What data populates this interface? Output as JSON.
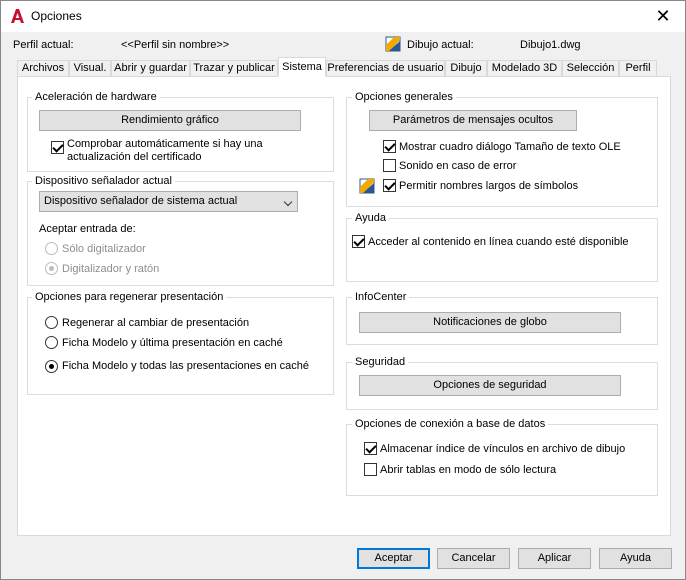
{
  "window": {
    "title": "Opciones",
    "close": "✕"
  },
  "profile": {
    "label": "Perfil actual:",
    "value": "<<Perfil sin nombre>>"
  },
  "drawing": {
    "label": "Dibujo actual:",
    "value": "Dibujo1.dwg"
  },
  "tabs": [
    {
      "label": "Archivos"
    },
    {
      "label": "Visual."
    },
    {
      "label": "Abrir y guardar"
    },
    {
      "label": "Trazar y publicar"
    },
    {
      "label": "Sistema"
    },
    {
      "label": "Preferencias de usuario"
    },
    {
      "label": "Dibujo"
    },
    {
      "label": "Modelado 3D"
    },
    {
      "label": "Selección"
    },
    {
      "label": "Perfil"
    }
  ],
  "hardware": {
    "title": "Aceleración de hardware",
    "button": "Rendimiento gráfico",
    "check_label_1": "Comprobar automáticamente si hay una",
    "check_label_2": "actualización del certificado"
  },
  "pointing": {
    "title": "Dispositivo señalador actual",
    "selected": "Dispositivo señalador de sistema actual",
    "accept_label": "Aceptar entrada de:",
    "radio1": "Sólo digitalizador",
    "radio2": "Digitalizador y ratón"
  },
  "regen": {
    "title": "Opciones para regenerar presentación",
    "opt1": "Regenerar al cambiar de presentación",
    "opt2": "Ficha Modelo y última presentación en caché",
    "opt3": "Ficha Modelo y todas las presentaciones en caché"
  },
  "general": {
    "title": "Opciones generales",
    "button": "Parámetros de mensajes ocultos",
    "chk1": "Mostrar cuadro diálogo Tamaño de texto OLE",
    "chk2": "Sonido en caso de error",
    "chk3": "Permitir nombres largos de símbolos"
  },
  "help": {
    "title": "Ayuda",
    "chk": "Acceder al contenido en línea cuando esté disponible"
  },
  "infocenter": {
    "title": "InfoCenter",
    "button": "Notificaciones de globo"
  },
  "security": {
    "title": "Seguridad",
    "button": "Opciones de seguridad"
  },
  "db": {
    "title": "Opciones de conexión a base de datos",
    "chk1": "Almacenar índice de vínculos en archivo de dibujo",
    "chk2": "Abrir tablas en modo de sólo lectura"
  },
  "footer": {
    "ok": "Aceptar",
    "cancel": "Cancelar",
    "apply": "Aplicar",
    "help": "Ayuda"
  },
  "colors": {
    "accent": "#0078d7",
    "brand": "#c8102e"
  }
}
